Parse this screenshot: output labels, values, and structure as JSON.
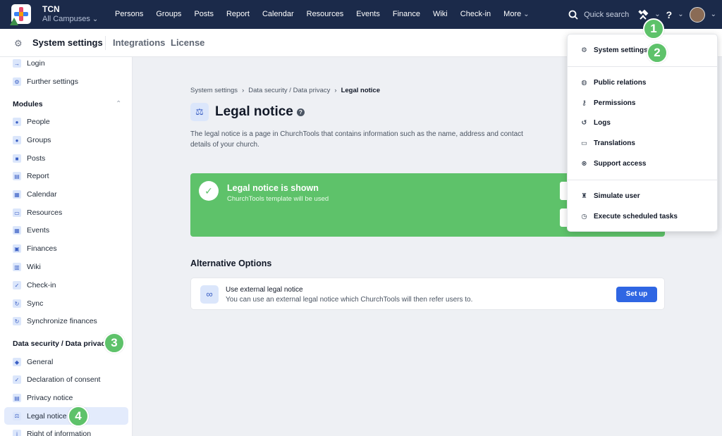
{
  "org": {
    "name": "TCN",
    "campus": "All Campuses"
  },
  "nav": [
    "Persons",
    "Groups",
    "Posts",
    "Report",
    "Calendar",
    "Resources",
    "Events",
    "Finance",
    "Wiki",
    "Check-in",
    "More"
  ],
  "search_placeholder": "Quick search",
  "subheader": {
    "title": "System settings",
    "tab_integrations": "Integrations",
    "tab_license": "License"
  },
  "sidebar": {
    "top_items": [
      "Login",
      "Further settings"
    ],
    "modules_heading": "Modules",
    "modules": [
      "People",
      "Groups",
      "Posts",
      "Report",
      "Calendar",
      "Resources",
      "Events",
      "Finances",
      "Wiki",
      "Check-in",
      "Sync",
      "Synchronize finances"
    ],
    "privacy_heading": "Data security / Data privacy",
    "privacy": [
      "General",
      "Declaration of consent",
      "Privacy notice",
      "Legal notice",
      "Right of information"
    ]
  },
  "breadcrumb": [
    "System settings",
    "Data security / Data privacy",
    "Legal notice"
  ],
  "page": {
    "title": "Legal notice",
    "description": "The legal notice is a page in ChurchTools that contains information such as the name, address and contact details of your church."
  },
  "banner": {
    "title": "Legal notice is shown",
    "subtitle": "ChurchTools template will be used"
  },
  "alternative": {
    "heading": "Alternative Options",
    "title": "Use external legal notice",
    "subtitle": "You can use an external legal notice which ChurchTools will then refer users to.",
    "button": "Set up"
  },
  "dropdown": {
    "items": [
      "System settings",
      "Public relations",
      "Permissions",
      "Logs",
      "Translations",
      "Support access",
      "Simulate user",
      "Execute scheduled tasks"
    ]
  },
  "markers": [
    "1",
    "2",
    "3",
    "4"
  ],
  "colors": {
    "nav_bg": "#1b2a4a",
    "accent": "#2f66e3",
    "success": "#5ec26a",
    "active_bg": "#e3ebfc"
  }
}
